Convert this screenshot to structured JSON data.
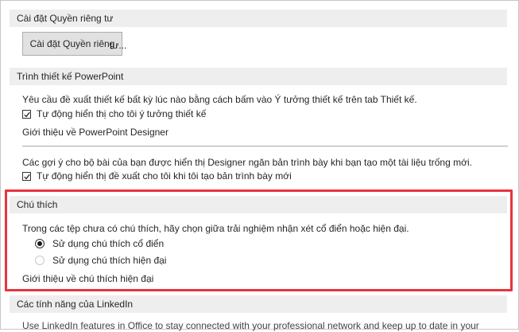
{
  "privacy": {
    "header": "Cài đặt Quyền riêng tư",
    "button_label": "Cài đặt Quyền riêng tư...",
    "button_visible": "Cài đặt Quyền riêng",
    "button_overflow": "tư..."
  },
  "designer": {
    "header": "Trình thiết kế PowerPoint",
    "description": "Yêu cầu đề xuất thiết kế bất kỳ lúc nào bằng cách bấm vào Ý tưởng thiết kế trên tab Thiết kế.",
    "auto_show_label": "Tự động hiển thị cho tôi ý tưởng thiết kế",
    "auto_show_checked": true,
    "about_link": "Giới thiệu về PowerPoint Designer",
    "suggestions_description": "Các gợi ý cho bộ bài của bạn được hiển thị Designer ngăn bản trình bày khi bạn tạo một tài liệu trống mới.",
    "auto_suggest_label": "Tự động hiển thị đề xuất cho tôi khi tôi tạo bản trình bày mới",
    "auto_suggest_checked": true
  },
  "comments": {
    "header": "Chú thích",
    "description": "Trong các tệp chưa có chú thích, hãy chọn giữa trải nghiệm nhận xét cổ điển hoặc hiện đại.",
    "options": [
      {
        "label": "Sử dụng chú thích cổ điển",
        "selected": true
      },
      {
        "label": "Sử dụng chú thích hiện đại",
        "selected": false
      }
    ],
    "about_link": "Giới thiệu về chú thích hiện đại",
    "highlight_color": "#e8343e"
  },
  "linkedin": {
    "header": "Các tính năng của LinkedIn",
    "description": "Use LinkedIn features in Office to stay connected with your professional network and keep up to date in your"
  }
}
